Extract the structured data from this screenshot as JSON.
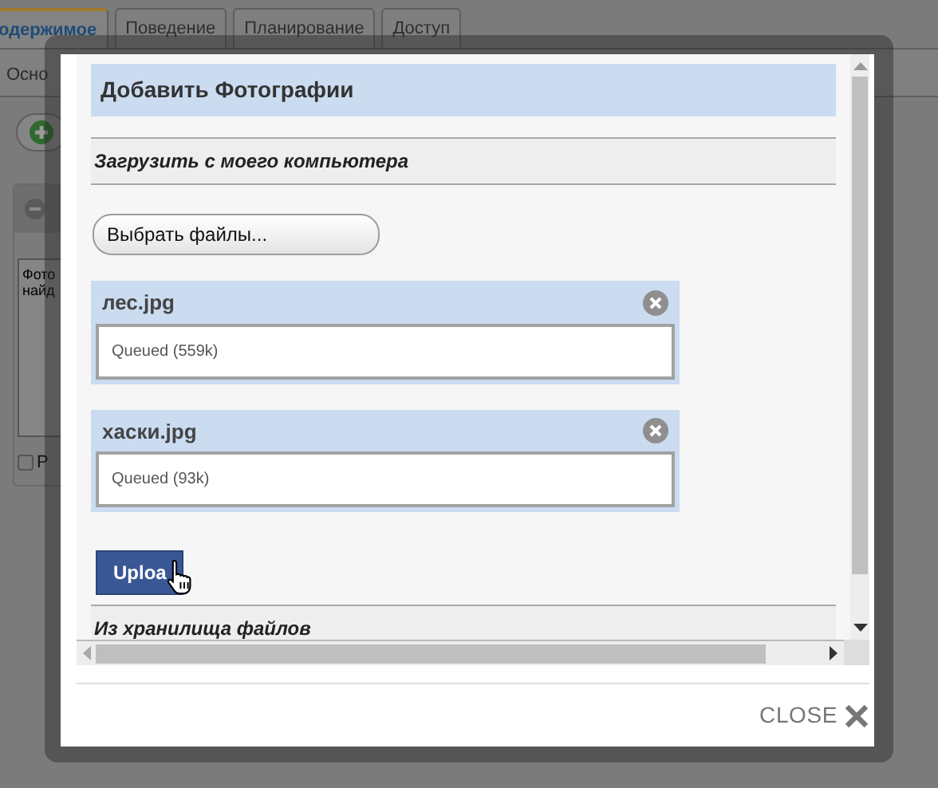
{
  "background_page": {
    "tabs": [
      {
        "label": "одержимое",
        "selected": true
      },
      {
        "label": "Поведение",
        "selected": false
      },
      {
        "label": "Планирование",
        "selected": false
      },
      {
        "label": "Доступ",
        "selected": false
      }
    ],
    "subtab": "Осно",
    "note_lines": [
      "Фото",
      "найд"
    ],
    "checkbox": {
      "label": "Р",
      "checked": false
    }
  },
  "dialog": {
    "title": "Добавить Фотографии",
    "sections": [
      {
        "kind": "upload",
        "heading": "Загрузить с моего компьютера",
        "choose_button": "Выбрать файлы...",
        "files": [
          {
            "name": "лес.jpg",
            "status": "Queued (559k)"
          },
          {
            "name": "хаски.jpg",
            "status": "Queued (93k)"
          }
        ],
        "upload_button": "Uploa"
      },
      {
        "kind": "storage",
        "heading": "Из хранилища файлов"
      }
    ],
    "close": "CLOSE"
  }
}
